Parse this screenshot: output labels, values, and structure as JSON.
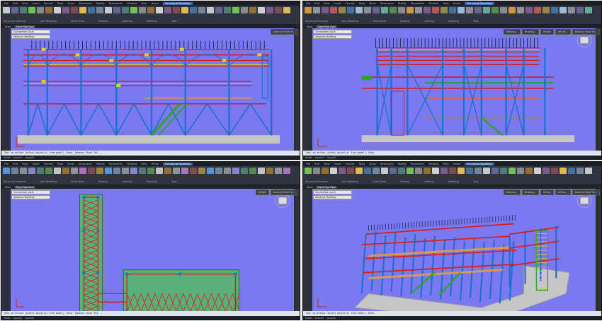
{
  "quadrants": [
    {
      "id": "q1",
      "title_tabs": [
        "File",
        "Edit",
        "View",
        "Insert",
        "Format",
        "Tools",
        "Draw",
        "Dimension",
        "Modify",
        "Parametric",
        "Window",
        "Help",
        "Home",
        "Structural Modeling"
      ],
      "active_title": "Structural Modeling",
      "ribbon_groups": [
        "Structural Elements",
        "Joint Modelling",
        "Model Draw",
        "Drawing",
        "Labelling",
        "Modelling",
        "Tools"
      ],
      "doc_tabs": [
        "Start",
        "Steel Pipe Rack"
      ],
      "active_doc": "Steel Pipe Rack",
      "palette": [
        "Connection vault",
        "Advance Building"
      ],
      "toolbar_right": [
        "Advance Steel Pal..."
      ],
      "command": "Cmd: ou action (select object(s) from model). Done. Advance Steel Pal...",
      "status": [
        "Model",
        "Layout1",
        "Layout2"
      ],
      "view": "front"
    },
    {
      "id": "q2",
      "title_tabs": [
        "File",
        "Edit",
        "View",
        "Insert",
        "Format",
        "Tools",
        "Draw",
        "Dimension",
        "Modify",
        "Parametric",
        "Window",
        "Help",
        "Home",
        "Structural Modeling"
      ],
      "active_title": "Structural Modeling",
      "ribbon_groups": [
        "Structural Elements",
        "Joint Modelling",
        "Model Draw",
        "Drawing",
        "Labelling",
        "Modelling",
        "Tools"
      ],
      "doc_tabs": [
        "Start",
        "Steel Pipe Rack"
      ],
      "active_doc": "Steel Pipe Rack",
      "palette": [
        "Connection vault",
        "Advance Building"
      ],
      "toolbar_right": [
        "Drawing...",
        "Drawing...",
        "Bridge",
        "Lift blo...",
        "Advance Steel Pal..."
      ],
      "command": "Cmd: ou action (select object(s) from model). Done.",
      "status": [
        "Model",
        "Layout1",
        "Layout2"
      ],
      "view": "side"
    },
    {
      "id": "q3",
      "title_tabs": [
        "File",
        "Edit",
        "View",
        "Insert",
        "Format",
        "Tools",
        "Draw",
        "Dimension",
        "Modify",
        "Parametric",
        "Window",
        "Help",
        "Home",
        "Structural Modeling"
      ],
      "active_title": "Structural Modeling",
      "ribbon_groups": [
        "Structural Elements",
        "Joint Modelling",
        "Model Draw",
        "Drawing",
        "Labelling",
        "Modelling",
        "Tools"
      ],
      "doc_tabs": [
        "Start",
        "Steel Pipe Rack"
      ],
      "active_doc": "Steel Pipe Rack",
      "palette": [
        "Connection vault",
        "Advance Building"
      ],
      "toolbar_right": [
        "Bridge",
        "Advance Steel Pal..."
      ],
      "command": "Cmd: ou action (select object(s) from model). Done. Advance Steel Pal...",
      "status": [
        "Model",
        "Layout1",
        "Layout2"
      ],
      "view": "top"
    },
    {
      "id": "q4",
      "title_tabs": [
        "File",
        "Edit",
        "View",
        "Insert",
        "Format",
        "Tools",
        "Draw",
        "Dimension",
        "Modify",
        "Parametric",
        "Window",
        "Help",
        "Home",
        "Structural Modeling"
      ],
      "active_title": "Structural Modeling",
      "ribbon_groups": [
        "Structural Elements",
        "Joint Modelling",
        "Model Draw",
        "Drawing",
        "Labelling",
        "Modelling",
        "Tools"
      ],
      "doc_tabs": [
        "Start",
        "Steel Pipe Rack"
      ],
      "active_doc": "Steel Pipe Rack",
      "palette": [
        "Connection vault",
        "Advance Building"
      ],
      "toolbar_right": [
        "Drawing...",
        "Drawing...",
        "Bridge",
        "Lift blo...",
        "Advance Steel Pal..."
      ],
      "command": "Cmd: ou action (select object(s) from model). Done.",
      "status": [
        "Model",
        "Layout1",
        "Layout2"
      ],
      "view": "iso"
    }
  ],
  "colors": {
    "viewport_bg": "#7b79f1",
    "column": "#1f6fd1",
    "beam": "#d42020",
    "bracing": "#2aa52a",
    "highlight": "#e2d21b",
    "grating": "#d99a4f",
    "ground": "#c6c6c6",
    "orange": "#e56b12"
  }
}
